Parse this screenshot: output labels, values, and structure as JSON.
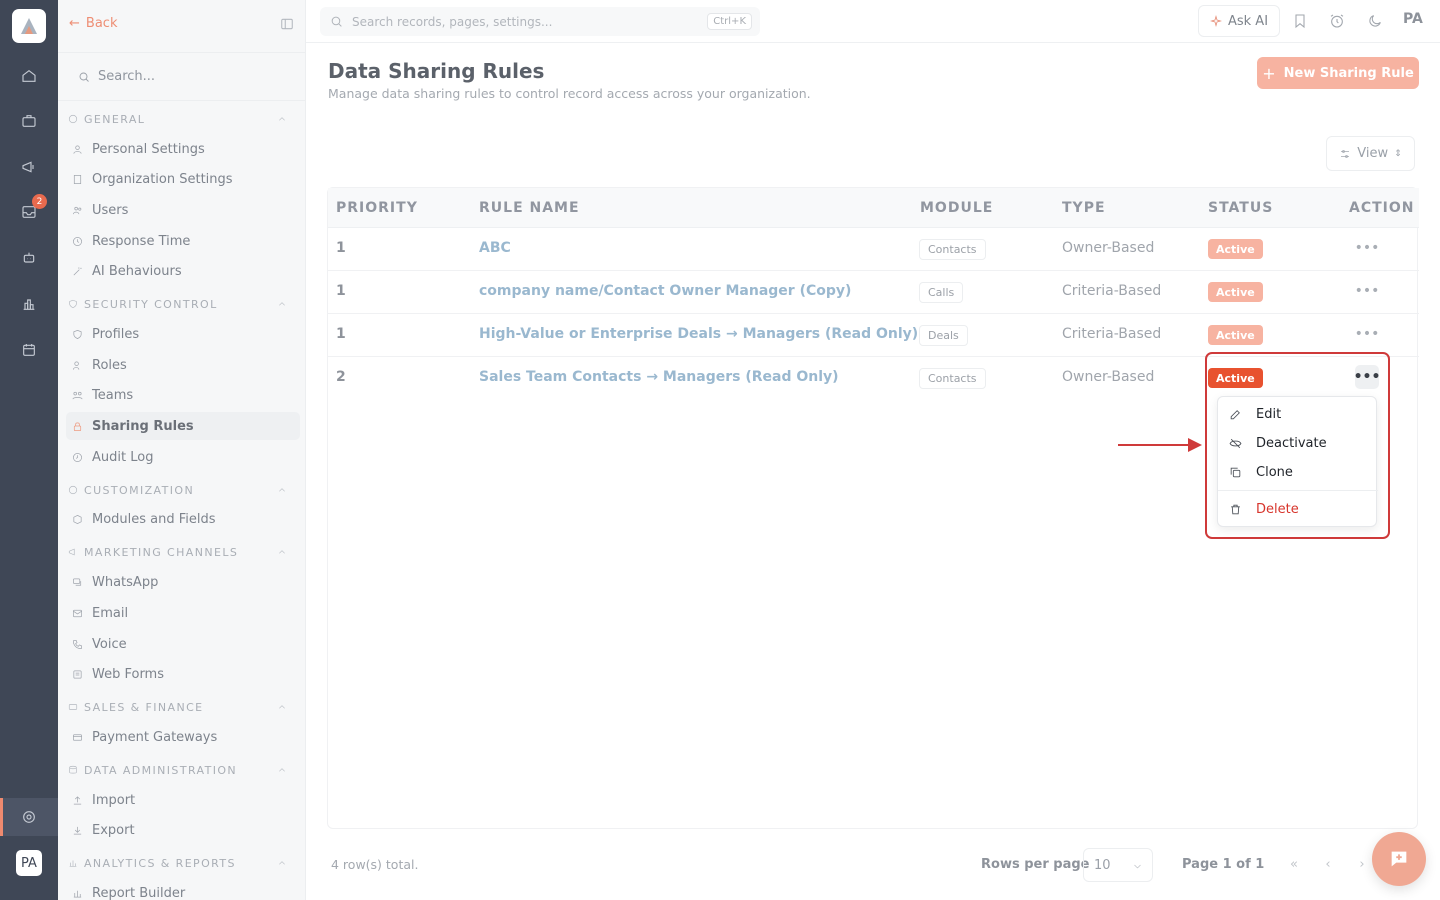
{
  "rail": {
    "badge": "2",
    "avatar": "PA"
  },
  "sidebar": {
    "back_label": "Back",
    "search_placeholder": "Search...",
    "sections": [
      {
        "label": "GENERAL",
        "items": [
          "Personal Settings",
          "Organization Settings",
          "Users",
          "Response Time",
          "AI Behaviours"
        ]
      },
      {
        "label": "SECURITY CONTROL",
        "items": [
          "Profiles",
          "Roles",
          "Teams",
          "Sharing Rules",
          "Audit Log"
        ]
      },
      {
        "label": "CUSTOMIZATION",
        "items": [
          "Modules and Fields"
        ]
      },
      {
        "label": "MARKETING CHANNELS",
        "items": [
          "WhatsApp",
          "Email",
          "Voice",
          "Web Forms"
        ]
      },
      {
        "label": "SALES & FINANCE",
        "items": [
          "Payment Gateways"
        ]
      },
      {
        "label": "DATA ADMINISTRATION",
        "items": [
          "Import",
          "Export"
        ]
      },
      {
        "label": "ANALYTICS & REPORTS",
        "items": [
          "Report Builder"
        ]
      }
    ]
  },
  "topbar": {
    "search_placeholder": "Search records, pages, settings...",
    "shortcut": "Ctrl+K",
    "ask_ai": "Ask AI",
    "user": "PA"
  },
  "page": {
    "title": "Data Sharing Rules",
    "subtitle": "Manage data sharing rules to control record access across your organization.",
    "new_button": "New Sharing Rule",
    "view_button": "View"
  },
  "table": {
    "headers": [
      "PRIORITY",
      "RULE NAME",
      "MODULE",
      "TYPE",
      "STATUS",
      "ACTION"
    ],
    "rows": [
      {
        "priority": "1",
        "name": "ABC",
        "module": "Contacts",
        "type": "Owner-Based",
        "status": "Active"
      },
      {
        "priority": "1",
        "name": "company name/Contact Owner Manager (Copy)",
        "module": "Calls",
        "type": "Criteria-Based",
        "status": "Active"
      },
      {
        "priority": "1",
        "name": "High-Value or Enterprise Deals → Managers (Read Only)",
        "module": "Deals",
        "type": "Criteria-Based",
        "status": "Active"
      },
      {
        "priority": "2",
        "name": "Sales Team Contacts → Managers (Read Only)",
        "module": "Contacts",
        "type": "Owner-Based",
        "status": "Active"
      }
    ],
    "action_glyph": "•••"
  },
  "menu": {
    "items": [
      "Edit",
      "Deactivate",
      "Clone",
      "Delete"
    ]
  },
  "footer": {
    "total": "4 row(s) total.",
    "rows_per_page_label": "Rows per page",
    "rows_per_page": "10",
    "page_info": "Page 1 of 1",
    "first": "«",
    "prev": "‹",
    "next": "›"
  },
  "colors": {
    "accent": "#e8522f",
    "highlight_box": "#cf3a3a",
    "rail": "#3f4756"
  }
}
